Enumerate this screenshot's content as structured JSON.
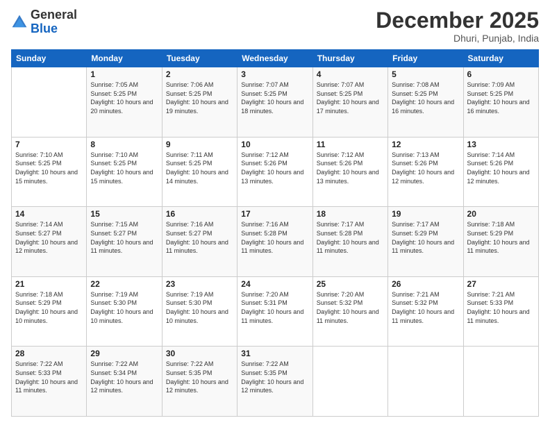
{
  "header": {
    "logo_general": "General",
    "logo_blue": "Blue",
    "month_title": "December 2025",
    "location": "Dhuri, Punjab, India"
  },
  "calendar": {
    "columns": [
      "Sunday",
      "Monday",
      "Tuesday",
      "Wednesday",
      "Thursday",
      "Friday",
      "Saturday"
    ],
    "weeks": [
      [
        {
          "day": "",
          "sunrise": "",
          "sunset": "",
          "daylight": ""
        },
        {
          "day": "1",
          "sunrise": "Sunrise: 7:05 AM",
          "sunset": "Sunset: 5:25 PM",
          "daylight": "Daylight: 10 hours and 20 minutes."
        },
        {
          "day": "2",
          "sunrise": "Sunrise: 7:06 AM",
          "sunset": "Sunset: 5:25 PM",
          "daylight": "Daylight: 10 hours and 19 minutes."
        },
        {
          "day": "3",
          "sunrise": "Sunrise: 7:07 AM",
          "sunset": "Sunset: 5:25 PM",
          "daylight": "Daylight: 10 hours and 18 minutes."
        },
        {
          "day": "4",
          "sunrise": "Sunrise: 7:07 AM",
          "sunset": "Sunset: 5:25 PM",
          "daylight": "Daylight: 10 hours and 17 minutes."
        },
        {
          "day": "5",
          "sunrise": "Sunrise: 7:08 AM",
          "sunset": "Sunset: 5:25 PM",
          "daylight": "Daylight: 10 hours and 16 minutes."
        },
        {
          "day": "6",
          "sunrise": "Sunrise: 7:09 AM",
          "sunset": "Sunset: 5:25 PM",
          "daylight": "Daylight: 10 hours and 16 minutes."
        }
      ],
      [
        {
          "day": "7",
          "sunrise": "Sunrise: 7:10 AM",
          "sunset": "Sunset: 5:25 PM",
          "daylight": "Daylight: 10 hours and 15 minutes."
        },
        {
          "day": "8",
          "sunrise": "Sunrise: 7:10 AM",
          "sunset": "Sunset: 5:25 PM",
          "daylight": "Daylight: 10 hours and 15 minutes."
        },
        {
          "day": "9",
          "sunrise": "Sunrise: 7:11 AM",
          "sunset": "Sunset: 5:25 PM",
          "daylight": "Daylight: 10 hours and 14 minutes."
        },
        {
          "day": "10",
          "sunrise": "Sunrise: 7:12 AM",
          "sunset": "Sunset: 5:26 PM",
          "daylight": "Daylight: 10 hours and 13 minutes."
        },
        {
          "day": "11",
          "sunrise": "Sunrise: 7:12 AM",
          "sunset": "Sunset: 5:26 PM",
          "daylight": "Daylight: 10 hours and 13 minutes."
        },
        {
          "day": "12",
          "sunrise": "Sunrise: 7:13 AM",
          "sunset": "Sunset: 5:26 PM",
          "daylight": "Daylight: 10 hours and 12 minutes."
        },
        {
          "day": "13",
          "sunrise": "Sunrise: 7:14 AM",
          "sunset": "Sunset: 5:26 PM",
          "daylight": "Daylight: 10 hours and 12 minutes."
        }
      ],
      [
        {
          "day": "14",
          "sunrise": "Sunrise: 7:14 AM",
          "sunset": "Sunset: 5:27 PM",
          "daylight": "Daylight: 10 hours and 12 minutes."
        },
        {
          "day": "15",
          "sunrise": "Sunrise: 7:15 AM",
          "sunset": "Sunset: 5:27 PM",
          "daylight": "Daylight: 10 hours and 11 minutes."
        },
        {
          "day": "16",
          "sunrise": "Sunrise: 7:16 AM",
          "sunset": "Sunset: 5:27 PM",
          "daylight": "Daylight: 10 hours and 11 minutes."
        },
        {
          "day": "17",
          "sunrise": "Sunrise: 7:16 AM",
          "sunset": "Sunset: 5:28 PM",
          "daylight": "Daylight: 10 hours and 11 minutes."
        },
        {
          "day": "18",
          "sunrise": "Sunrise: 7:17 AM",
          "sunset": "Sunset: 5:28 PM",
          "daylight": "Daylight: 10 hours and 11 minutes."
        },
        {
          "day": "19",
          "sunrise": "Sunrise: 7:17 AM",
          "sunset": "Sunset: 5:29 PM",
          "daylight": "Daylight: 10 hours and 11 minutes."
        },
        {
          "day": "20",
          "sunrise": "Sunrise: 7:18 AM",
          "sunset": "Sunset: 5:29 PM",
          "daylight": "Daylight: 10 hours and 11 minutes."
        }
      ],
      [
        {
          "day": "21",
          "sunrise": "Sunrise: 7:18 AM",
          "sunset": "Sunset: 5:29 PM",
          "daylight": "Daylight: 10 hours and 10 minutes."
        },
        {
          "day": "22",
          "sunrise": "Sunrise: 7:19 AM",
          "sunset": "Sunset: 5:30 PM",
          "daylight": "Daylight: 10 hours and 10 minutes."
        },
        {
          "day": "23",
          "sunrise": "Sunrise: 7:19 AM",
          "sunset": "Sunset: 5:30 PM",
          "daylight": "Daylight: 10 hours and 10 minutes."
        },
        {
          "day": "24",
          "sunrise": "Sunrise: 7:20 AM",
          "sunset": "Sunset: 5:31 PM",
          "daylight": "Daylight: 10 hours and 11 minutes."
        },
        {
          "day": "25",
          "sunrise": "Sunrise: 7:20 AM",
          "sunset": "Sunset: 5:32 PM",
          "daylight": "Daylight: 10 hours and 11 minutes."
        },
        {
          "day": "26",
          "sunrise": "Sunrise: 7:21 AM",
          "sunset": "Sunset: 5:32 PM",
          "daylight": "Daylight: 10 hours and 11 minutes."
        },
        {
          "day": "27",
          "sunrise": "Sunrise: 7:21 AM",
          "sunset": "Sunset: 5:33 PM",
          "daylight": "Daylight: 10 hours and 11 minutes."
        }
      ],
      [
        {
          "day": "28",
          "sunrise": "Sunrise: 7:22 AM",
          "sunset": "Sunset: 5:33 PM",
          "daylight": "Daylight: 10 hours and 11 minutes."
        },
        {
          "day": "29",
          "sunrise": "Sunrise: 7:22 AM",
          "sunset": "Sunset: 5:34 PM",
          "daylight": "Daylight: 10 hours and 12 minutes."
        },
        {
          "day": "30",
          "sunrise": "Sunrise: 7:22 AM",
          "sunset": "Sunset: 5:35 PM",
          "daylight": "Daylight: 10 hours and 12 minutes."
        },
        {
          "day": "31",
          "sunrise": "Sunrise: 7:22 AM",
          "sunset": "Sunset: 5:35 PM",
          "daylight": "Daylight: 10 hours and 12 minutes."
        },
        {
          "day": "",
          "sunrise": "",
          "sunset": "",
          "daylight": ""
        },
        {
          "day": "",
          "sunrise": "",
          "sunset": "",
          "daylight": ""
        },
        {
          "day": "",
          "sunrise": "",
          "sunset": "",
          "daylight": ""
        }
      ]
    ]
  }
}
